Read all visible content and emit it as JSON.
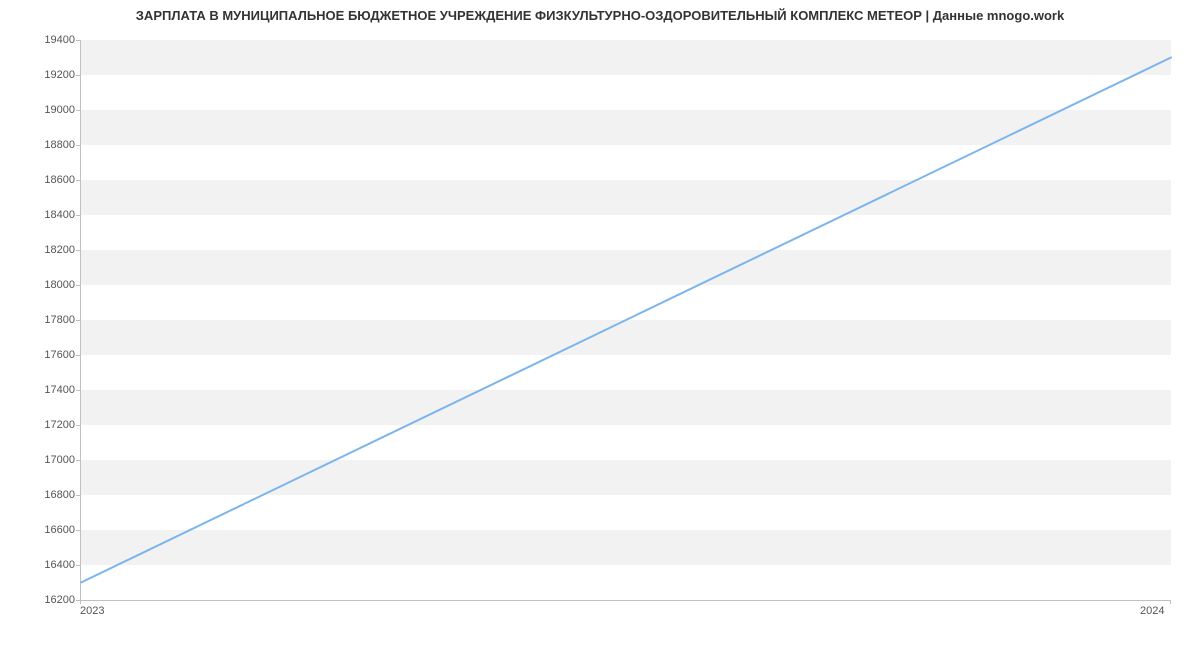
{
  "chart_data": {
    "type": "line",
    "title": "ЗАРПЛАТА В МУНИЦИПАЛЬНОЕ БЮДЖЕТНОЕ УЧРЕЖДЕНИЕ ФИЗКУЛЬТУРНО-ОЗДОРОВИТЕЛЬНЫЙ КОМПЛЕКС МЕТЕОР | Данные mnogo.work",
    "xlabel": "",
    "ylabel": "",
    "x": [
      2023,
      2024
    ],
    "x_tick_labels": [
      "2023",
      "2024"
    ],
    "y_ticks": [
      16200,
      16400,
      16600,
      16800,
      17000,
      17200,
      17400,
      17600,
      17800,
      18000,
      18200,
      18400,
      18600,
      18800,
      19000,
      19200,
      19400
    ],
    "ylim": [
      16200,
      19400
    ],
    "series": [
      {
        "name": "Зарплата",
        "values": [
          16300,
          19300
        ],
        "color": "#7cb5ec"
      }
    ],
    "grid": true
  }
}
